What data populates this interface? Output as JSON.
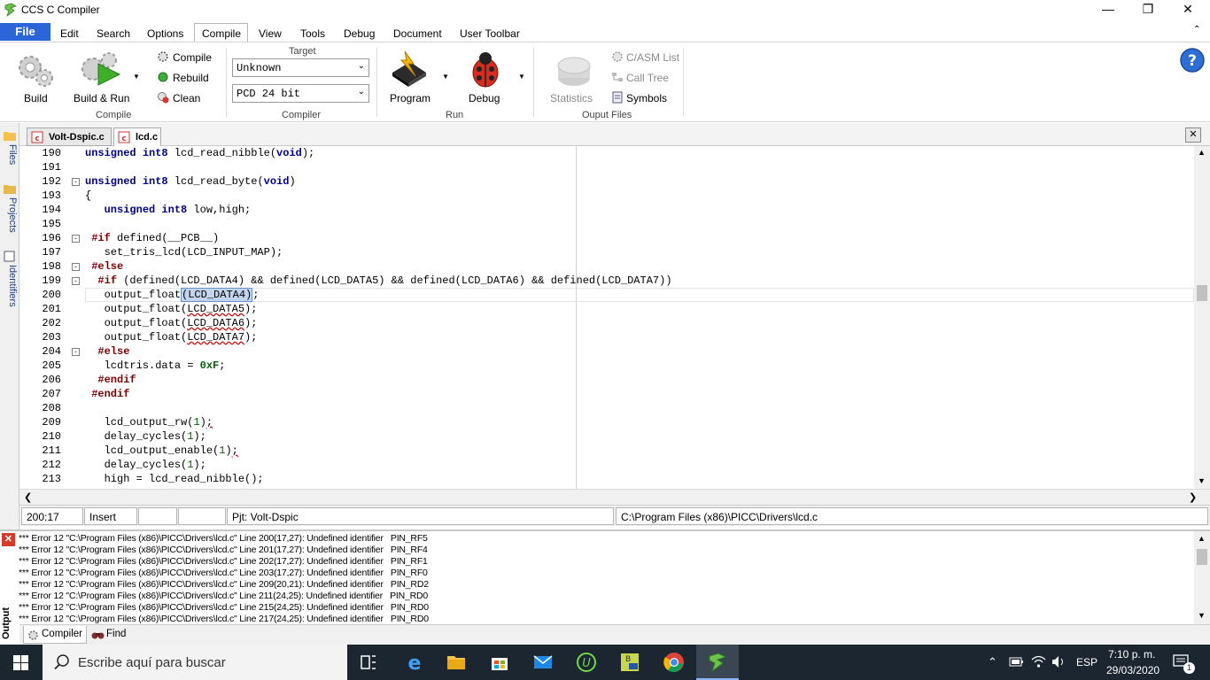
{
  "window": {
    "title": "CCS C Compiler"
  },
  "menu": [
    "File",
    "Edit",
    "Search",
    "Options",
    "Compile",
    "View",
    "Tools",
    "Debug",
    "Document",
    "User Toolbar"
  ],
  "ribbon": {
    "build": "Build",
    "build_run": "Build & Run",
    "compile": "Compile",
    "rebuild": "Rebuild",
    "clean": "Clean",
    "group_compile": "Compile",
    "target_label": "Target",
    "target_value": "Unknown",
    "compiler_value": "PCD 24 bit",
    "group_compiler": "Compiler",
    "program": "Program",
    "debug": "Debug",
    "group_run": "Run",
    "statistics": "Statistics",
    "c_asm_list": "C/ASM List",
    "call_tree": "Call Tree",
    "symbols": "Symbols",
    "group_output": "Ouput Files"
  },
  "side_tabs": [
    "Files",
    "Projects",
    "Identifiers"
  ],
  "editor_tabs": [
    "Volt-Dspic.c",
    "lcd.c"
  ],
  "lines": [
    {
      "n": "190",
      "fold": "",
      "text": "unsigned int8 lcd_read_nibble(void);"
    },
    {
      "n": "191",
      "fold": "",
      "text": ""
    },
    {
      "n": "192",
      "fold": "-",
      "text": "unsigned int8 lcd_read_byte(void)"
    },
    {
      "n": "193",
      "fold": "",
      "text": "{"
    },
    {
      "n": "194",
      "fold": "",
      "text": "   unsigned int8 low,high;"
    },
    {
      "n": "195",
      "fold": "",
      "text": ""
    },
    {
      "n": "196",
      "fold": "-",
      "text": " #if defined(__PCB__)"
    },
    {
      "n": "197",
      "fold": "",
      "text": "   set_tris_lcd(LCD_INPUT_MAP);"
    },
    {
      "n": "198",
      "fold": "-",
      "text": " #else"
    },
    {
      "n": "199",
      "fold": "-",
      "text": "  #if (defined(LCD_DATA4) && defined(LCD_DATA5) && defined(LCD_DATA6) && defined(LCD_DATA7))"
    },
    {
      "n": "200",
      "fold": "",
      "text": "   output_float(LCD_DATA4);"
    },
    {
      "n": "201",
      "fold": "",
      "text": "   output_float(LCD_DATA5);"
    },
    {
      "n": "202",
      "fold": "",
      "text": "   output_float(LCD_DATA6);"
    },
    {
      "n": "203",
      "fold": "",
      "text": "   output_float(LCD_DATA7);"
    },
    {
      "n": "204",
      "fold": "-",
      "text": "  #else"
    },
    {
      "n": "205",
      "fold": "",
      "text": "   lcdtris.data = 0xF;"
    },
    {
      "n": "206",
      "fold": "",
      "text": "  #endif"
    },
    {
      "n": "207",
      "fold": "",
      "text": " #endif"
    },
    {
      "n": "208",
      "fold": "",
      "text": ""
    },
    {
      "n": "209",
      "fold": "",
      "text": "   lcd_output_rw(1);"
    },
    {
      "n": "210",
      "fold": "",
      "text": "   delay_cycles(1);"
    },
    {
      "n": "211",
      "fold": "",
      "text": "   lcd_output_enable(1);"
    },
    {
      "n": "212",
      "fold": "",
      "text": "   delay_cycles(1);"
    },
    {
      "n": "213",
      "fold": "",
      "text": "   high = lcd_read_nibble();"
    }
  ],
  "status": {
    "position": "200:17",
    "mode": "Insert",
    "project": "Pjt: Volt-Dspic",
    "path": "C:\\Program Files (x86)\\PICC\\Drivers\\lcd.c"
  },
  "output": [
    "*** Error 12 \"C:\\Program Files (x86)\\PICC\\Drivers\\lcd.c\" Line 200(17,27): Undefined identifier   PIN_RF5",
    "*** Error 12 \"C:\\Program Files (x86)\\PICC\\Drivers\\lcd.c\" Line 201(17,27): Undefined identifier   PIN_RF4",
    "*** Error 12 \"C:\\Program Files (x86)\\PICC\\Drivers\\lcd.c\" Line 202(17,27): Undefined identifier   PIN_RF1",
    "*** Error 12 \"C:\\Program Files (x86)\\PICC\\Drivers\\lcd.c\" Line 203(17,27): Undefined identifier   PIN_RF0",
    "*** Error 12 \"C:\\Program Files (x86)\\PICC\\Drivers\\lcd.c\" Line 209(20,21): Undefined identifier   PIN_RD2",
    "*** Error 12 \"C:\\Program Files (x86)\\PICC\\Drivers\\lcd.c\" Line 211(24,25): Undefined identifier   PIN_RD0",
    "*** Error 12 \"C:\\Program Files (x86)\\PICC\\Drivers\\lcd.c\" Line 215(24,25): Undefined identifier   PIN_RD0",
    "*** Error 12 \"C:\\Program Files (x86)\\PICC\\Drivers\\lcd.c\" Line 217(24,25): Undefined identifier   PIN_RD0"
  ],
  "output_label": "Output",
  "output_tabs": [
    "Compiler",
    "Find"
  ],
  "taskbar": {
    "search_placeholder": "Escribe aquí para buscar",
    "lang": "ESP",
    "time": "7:10 p. m.",
    "date": "29/03/2020",
    "notifications": "1"
  }
}
